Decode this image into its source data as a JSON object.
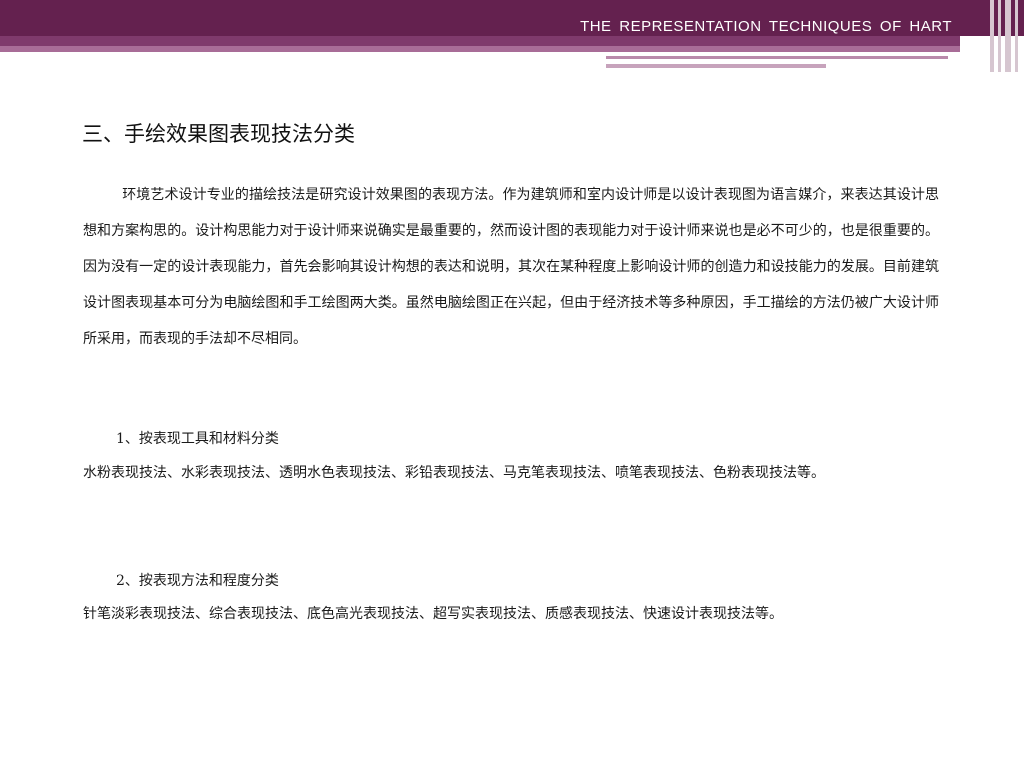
{
  "header": {
    "title": "THE  REPRESENTATION  TECHNIQUES  OF  HART"
  },
  "section": {
    "heading": "三、手绘效果图表现技法分类",
    "intro": "环境艺术设计专业的描绘技法是研究设计效果图的表现方法。作为建筑师和室内设计师是以设计表现图为语言媒介，来表达其设计思想和方案构思的。设计构思能力对于设计师来说确实是最重要的，然而设计图的表现能力对于设计师来说也是必不可少的，也是很重要的。因为没有一定的设计表现能力，首先会影响其设计构想的表达和说明，其次在某种程度上影响设计师的创造力和设技能力的发展。目前建筑设计图表现基本可分为电脑绘图和手工绘图两大类。虽然电脑绘图正在兴起，但由于经济技术等多种原因，手工描绘的方法仍被广大设计师所采用，而表现的手法却不尽相同。",
    "items": [
      {
        "heading": "1、按表现工具和材料分类",
        "text": "水粉表现技法、水彩表现技法、透明水色表现技法、彩铅表现技法、马克笔表现技法、喷笔表现技法、色粉表现技法等。"
      },
      {
        "heading": "2、按表现方法和程度分类",
        "text": "针笔淡彩表现技法、综合表现技法、底色高光表现技法、超写实表现技法、质感表现技法、快速设计表现技法等。"
      }
    ]
  },
  "colors": {
    "header_dark": "#64214f",
    "header_mid": "#7f3a6c",
    "header_light": "#a86c97"
  }
}
